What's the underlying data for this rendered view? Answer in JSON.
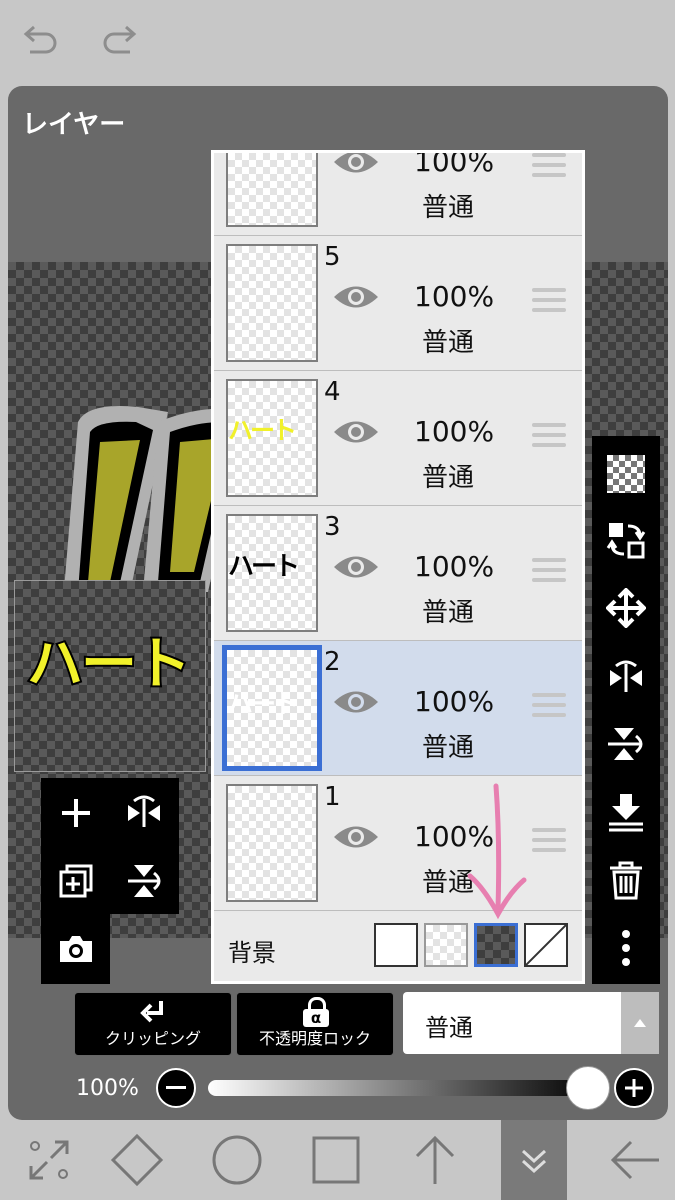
{
  "panel": {
    "title": "レイヤー"
  },
  "preview": {
    "text": "ハート"
  },
  "layers": [
    {
      "number": "",
      "opacity": "100%",
      "blend": "普通",
      "selected": false,
      "thumb_text": ""
    },
    {
      "number": "5",
      "opacity": "100%",
      "blend": "普通",
      "selected": false,
      "thumb_text": ""
    },
    {
      "number": "4",
      "opacity": "100%",
      "blend": "普通",
      "selected": false,
      "thumb_text": "ハート"
    },
    {
      "number": "3",
      "opacity": "100%",
      "blend": "普通",
      "selected": false,
      "thumb_text": "ハート"
    },
    {
      "number": "2",
      "opacity": "100%",
      "blend": "普通",
      "selected": true,
      "thumb_text": "ハート"
    },
    {
      "number": "1",
      "opacity": "100%",
      "blend": "普通",
      "selected": false,
      "thumb_text": ""
    }
  ],
  "background": {
    "label": "背景",
    "options": [
      "white",
      "transparent-light",
      "transparent-dark",
      "none"
    ],
    "selected": "transparent-dark"
  },
  "controls": {
    "clipping_label": "クリッピング",
    "lock_label": "不透明度ロック",
    "lock_symbol": "α",
    "blend_mode": "普通",
    "opacity_label": "100%",
    "opacity_value": 1.0
  },
  "colors": {
    "selected_row": "#d2dcec",
    "selection_border": "#3b6fd4",
    "text_yellow": "#f1f12a",
    "annotation_arrow": "#e77fb0"
  }
}
